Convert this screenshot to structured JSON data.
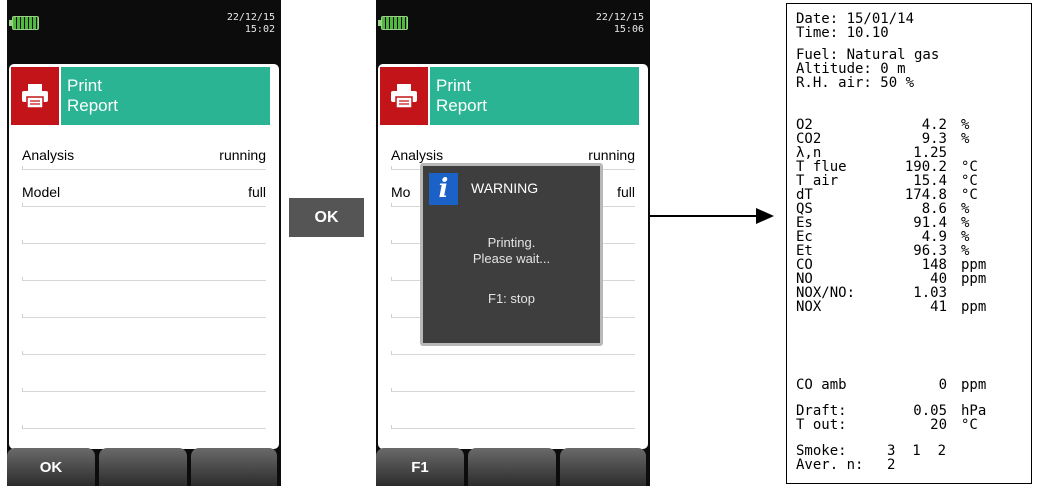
{
  "left_device": {
    "status": {
      "date": "22/12/15",
      "time": "15:02"
    },
    "header": {
      "title_line1": "Print",
      "title_line2": "Report",
      "icon": "printer-icon"
    },
    "rows": [
      {
        "label": "Analysis",
        "value": "running"
      },
      {
        "label": "Model",
        "value": "full"
      }
    ],
    "fkeys": [
      "OK",
      "",
      ""
    ]
  },
  "center_button": {
    "label": "OK"
  },
  "right_device": {
    "status": {
      "date": "22/12/15",
      "time": "15:06"
    },
    "header": {
      "title_line1": "Print",
      "title_line2": "Report",
      "icon": "printer-icon"
    },
    "rows": [
      {
        "label": "Analysis",
        "value": "running"
      },
      {
        "label": "Mo",
        "value": "full"
      }
    ],
    "dialog": {
      "icon": "info-icon",
      "title": "WARNING",
      "line1": "Printing.",
      "line2": "Please wait...",
      "stop": "F1: stop"
    },
    "fkeys": [
      "F1",
      "",
      ""
    ]
  },
  "receipt": {
    "date": "Date: 15/01/14",
    "time": "Time: 10.10",
    "fuel": "Fuel: Natural gas",
    "altitude": "Altitude: 0 m",
    "rh": "R.H. air: 50 %",
    "measurements": [
      {
        "name": "O2",
        "value": "4.2",
        "unit": "%"
      },
      {
        "name": "CO2",
        "value": "9.3",
        "unit": "%"
      },
      {
        "name": "λ,n",
        "value": "1.25",
        "unit": ""
      },
      {
        "name": "T flue",
        "value": "190.2",
        "unit": "°C"
      },
      {
        "name": "T air",
        "value": "15.4",
        "unit": "°C"
      },
      {
        "name": "dT",
        "value": "174.8",
        "unit": "°C"
      },
      {
        "name": "QS",
        "value": "8.6",
        "unit": "%"
      },
      {
        "name": "Es",
        "value": "91.4",
        "unit": "%"
      },
      {
        "name": "Ec",
        "value": "4.9",
        "unit": "%"
      },
      {
        "name": "Et",
        "value": "96.3",
        "unit": "%"
      },
      {
        "name": "CO",
        "value": "148",
        "unit": "ppm"
      },
      {
        "name": "NO",
        "value": "40",
        "unit": "ppm"
      },
      {
        "name": "NOX/NO:",
        "value": "1.03",
        "unit": ""
      },
      {
        "name": "NOX",
        "value": "41",
        "unit": "ppm"
      }
    ],
    "co_amb": {
      "name": "CO amb",
      "value": "0",
      "unit": "ppm"
    },
    "draft": {
      "name": "Draft:",
      "value": "0.05",
      "unit": "hPa"
    },
    "t_out": {
      "name": "T out:",
      "value": "20",
      "unit": "°C"
    },
    "smoke": {
      "name": "Smoke:",
      "values": "3  1  2"
    },
    "aver": {
      "name": "Aver. n:",
      "value": "2"
    }
  },
  "colors": {
    "accent": "#2bb494",
    "print_red": "#c3141a",
    "info_blue": "#1a62c7",
    "dialog_bg": "#3e3e3e"
  }
}
